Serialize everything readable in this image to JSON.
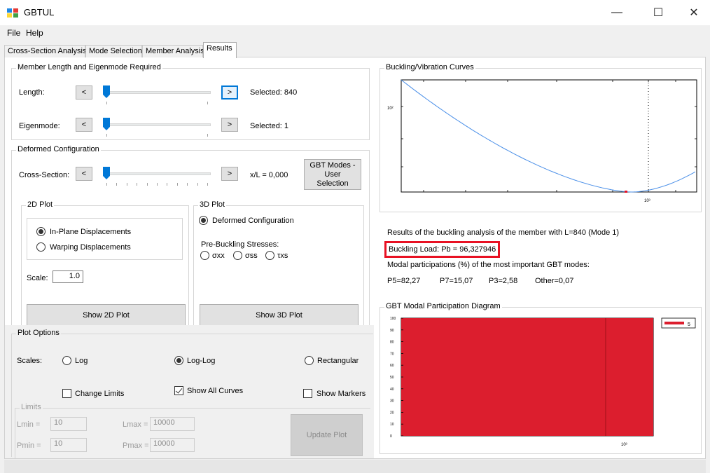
{
  "window": {
    "title": "GBTUL",
    "icon": "app-icon",
    "controls": {
      "minimize": "—",
      "maximize": "☐",
      "close": "✕"
    }
  },
  "menu": [
    "File",
    "Help"
  ],
  "tabs": [
    "Cross-Section Analysis",
    "Mode Selection",
    "Member Analysis",
    "Results"
  ],
  "active_tab": "Results",
  "member": {
    "title": "Member Length and Eigenmode Required",
    "length_label": "Length:",
    "eigenmode_label": "Eigenmode:",
    "prev": "<",
    "next": ">",
    "length_selected": "Selected:  840",
    "eigen_selected": "Selected:  1"
  },
  "deformed": {
    "title": "Deformed Configuration",
    "cs_label": "Cross-Section:",
    "xl_text": "x/L =  0,000",
    "gbt_button": "GBT Modes - User Selection",
    "plot2d": {
      "title": "2D Plot",
      "opt_inplane": "In-Plane Displacements",
      "opt_warping": "Warping Displacements",
      "scale_label": "Scale:",
      "scale_value": "1.0",
      "show_button": "Show 2D Plot"
    },
    "plot3d": {
      "title": "3D Plot",
      "opt_deformed": "Deformed Configuration",
      "stresses_label": "Pre-Buckling Stresses:",
      "opt_sxx": "σxx",
      "opt_sss": "σss",
      "opt_txs": "τxs",
      "show_button": "Show 3D Plot"
    }
  },
  "plot_options": {
    "title": "Plot Options",
    "scales_label": "Scales:",
    "opt_log": "Log",
    "opt_loglog": "Log-Log",
    "opt_rect": "Rectangular",
    "change_limits": "Change Limits",
    "show_all_curves": "Show All Curves",
    "show_markers": "Show Markers",
    "limits_title": "Limits",
    "lmin_label": "Lmin =",
    "lmin_value": "10",
    "lmax_label": "Lmax =",
    "lmax_value": "10000",
    "pmin_label": "Pmin =",
    "pmin_value": "10",
    "pmax_label": "Pmax =",
    "pmax_value": "10000",
    "update_button": "Update Plot"
  },
  "buckling_curves": {
    "title": "Buckling/Vibration Curves",
    "y_tick": "10²",
    "x_tick": "10³"
  },
  "results": {
    "summary": "Results of the buckling analysis of the member with L=840 (Mode 1)",
    "buckling_load": "Buckling Load: Pb = 96,327946",
    "modal_title": "Modal participations (%) of the most important GBT modes:",
    "modes": [
      "P5=82,27",
      "P7=15,07",
      "P3=2,58",
      "Other=0,07"
    ],
    "highlight_color": "#e81123"
  },
  "modal_diagram": {
    "title": "GBT Modal Participation Diagram",
    "y_ticks": [
      "100",
      "90",
      "80",
      "70",
      "60",
      "50",
      "40",
      "30",
      "20",
      "10",
      "0"
    ],
    "x_tick": "10³",
    "legend": "5",
    "fill_color": "#dc1e2e",
    "mode5_share_percent": 100
  }
}
